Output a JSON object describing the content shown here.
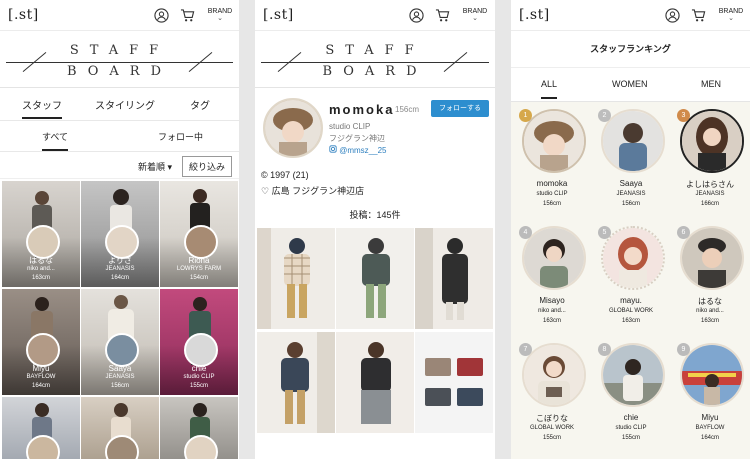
{
  "header": {
    "logo": "[.st]",
    "brand_label": "BRAND",
    "brand_chevron": "⌄"
  },
  "staffboard": {
    "line1": "STAFF",
    "line2": "BOARD"
  },
  "panel1": {
    "tabs": [
      "スタッフ",
      "スタイリング",
      "タグ"
    ],
    "subtabs": [
      "すべて",
      "フォロー中"
    ],
    "sort_label": "新着順 ▾",
    "filter_label": "絞り込み",
    "cells": [
      {
        "name": "はるな",
        "brand": "niko and...",
        "height": "163cm"
      },
      {
        "name": "よりさ",
        "brand": "JEANASIS",
        "height": "164cm"
      },
      {
        "name": "Riona",
        "brand": "LOWRYS FARM",
        "height": "154cm"
      },
      {
        "name": "Miyu",
        "brand": "BAYFLOW",
        "height": "164cm"
      },
      {
        "name": "Saaya",
        "brand": "JEANASIS",
        "height": "156cm"
      },
      {
        "name": "chie",
        "brand": "studio CLIP",
        "height": "155cm"
      },
      {
        "name": "",
        "brand": "",
        "height": ""
      },
      {
        "name": "",
        "brand": "",
        "height": ""
      },
      {
        "name": "",
        "brand": "",
        "height": ""
      }
    ]
  },
  "panel2": {
    "name": "momoka",
    "height": "156cm",
    "follow_label": "フォローする",
    "brand": "studio CLIP",
    "shop": "フジグラン神辺",
    "instagram": "@mmsz__25",
    "birth": "© 1997 (21)",
    "location": "♡ 広島 フジグラン神辺店",
    "posts": "投稿：145件"
  },
  "panel3": {
    "title": "スタッフランキング",
    "tabs": [
      "ALL",
      "WOMEN",
      "MEN"
    ],
    "ranks": [
      {
        "num": "1",
        "name": "momoka",
        "brand": "studio CLIP",
        "height": "156cm"
      },
      {
        "num": "2",
        "name": "Saaya",
        "brand": "JEANASIS",
        "height": "156cm"
      },
      {
        "num": "3",
        "name": "よしはらさん",
        "brand": "JEANASIS",
        "height": "166cm"
      },
      {
        "num": "4",
        "name": "Misayo",
        "brand": "niko and...",
        "height": "163cm"
      },
      {
        "num": "5",
        "name": "mayu.",
        "brand": "GLOBAL WORK",
        "height": "163cm"
      },
      {
        "num": "6",
        "name": "はるな",
        "brand": "niko and...",
        "height": "163cm"
      },
      {
        "num": "7",
        "name": "こぼりな",
        "brand": "GLOBAL WORK",
        "height": "155cm"
      },
      {
        "num": "8",
        "name": "chie",
        "brand": "studio CLIP",
        "height": "155cm"
      },
      {
        "num": "9",
        "name": "Miyu",
        "brand": "BAYFLOW",
        "height": "164cm"
      }
    ]
  },
  "icons": {
    "user": "user-icon",
    "cart": "cart-icon",
    "instagram": "instagram-icon"
  },
  "colors": {
    "accent_blue": "#2d8ecf",
    "rank_gold": "#d6a84b",
    "rank_silver": "#bdbdbd",
    "rank_bronze": "#d08a4a"
  }
}
